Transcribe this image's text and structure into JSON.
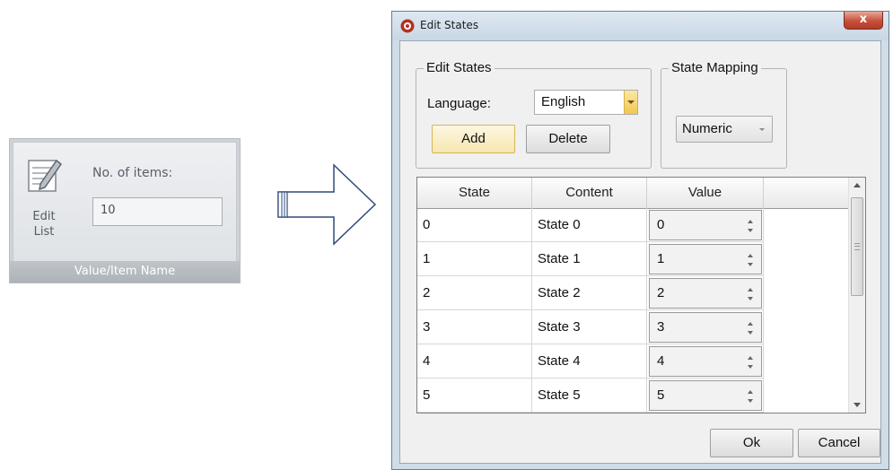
{
  "ribbon": {
    "edit_list_label": "Edit\nList",
    "items_label": "No. of items:",
    "items_value": "10",
    "footer_label": "Value/Item Name"
  },
  "dialog": {
    "title": "Edit States",
    "close_label": "x",
    "edit_states": {
      "group_title": "Edit States",
      "language_label": "Language:",
      "language_value": "English",
      "add_label": "Add",
      "delete_label": "Delete"
    },
    "state_mapping": {
      "group_title": "State Mapping",
      "value": "Numeric"
    },
    "grid": {
      "columns": [
        "State",
        "Content",
        "Value"
      ],
      "rows": [
        {
          "state": "0",
          "content": "State 0",
          "value": "0"
        },
        {
          "state": "1",
          "content": "State 1",
          "value": "1"
        },
        {
          "state": "2",
          "content": "State 2",
          "value": "2"
        },
        {
          "state": "3",
          "content": "State 3",
          "value": "3"
        },
        {
          "state": "4",
          "content": "State 4",
          "value": "4"
        },
        {
          "state": "5",
          "content": "State 5",
          "value": "5"
        }
      ]
    },
    "ok_label": "Ok",
    "cancel_label": "Cancel"
  }
}
